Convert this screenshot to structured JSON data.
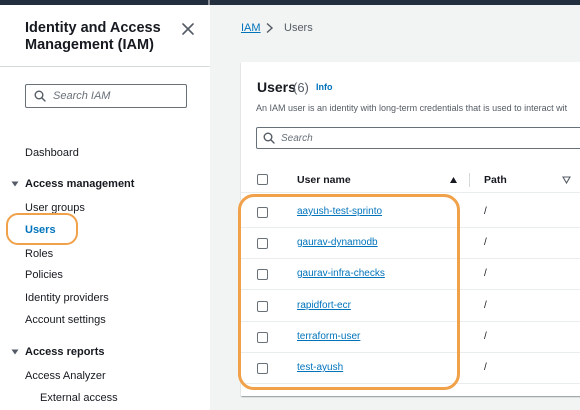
{
  "sidebar": {
    "title": "Identity and Access Management (IAM)",
    "search_placeholder": "Search IAM",
    "dashboard": "Dashboard",
    "access_management": {
      "label": "Access management",
      "items": [
        "User groups",
        "Users",
        "Roles",
        "Policies",
        "Identity providers",
        "Account settings"
      ]
    },
    "access_reports": {
      "label": "Access reports",
      "items": [
        "Access Analyzer",
        "External access"
      ]
    },
    "active_item": "Users"
  },
  "breadcrumb": {
    "root": "IAM",
    "current": "Users"
  },
  "users_panel": {
    "heading": "Users",
    "count": "(6)",
    "info_link": "Info",
    "description": "An IAM user is an identity with long-term credentials that is used to interact wit",
    "search_placeholder": "Search",
    "columns": {
      "user_name": "User name",
      "path": "Path"
    },
    "rows": [
      {
        "user_name": "aayush-test-sprinto",
        "path": "/"
      },
      {
        "user_name": "gaurav-dynamodb",
        "path": "/"
      },
      {
        "user_name": "gaurav-infra-checks",
        "path": "/"
      },
      {
        "user_name": "rapidfort-ecr",
        "path": "/"
      },
      {
        "user_name": "terraform-user",
        "path": "/"
      },
      {
        "user_name": "test-ayush",
        "path": "/"
      }
    ]
  },
  "colors": {
    "link": "#0073bb",
    "highlight_ring": "#f0a14a",
    "top_bar": "#232f3e",
    "page_bg": "#f2f3f3"
  },
  "icons": [
    "close-icon",
    "search-icon",
    "chevron-right-icon",
    "caret-down-icon",
    "sort-ascending-icon",
    "sort-descending-icon"
  ]
}
